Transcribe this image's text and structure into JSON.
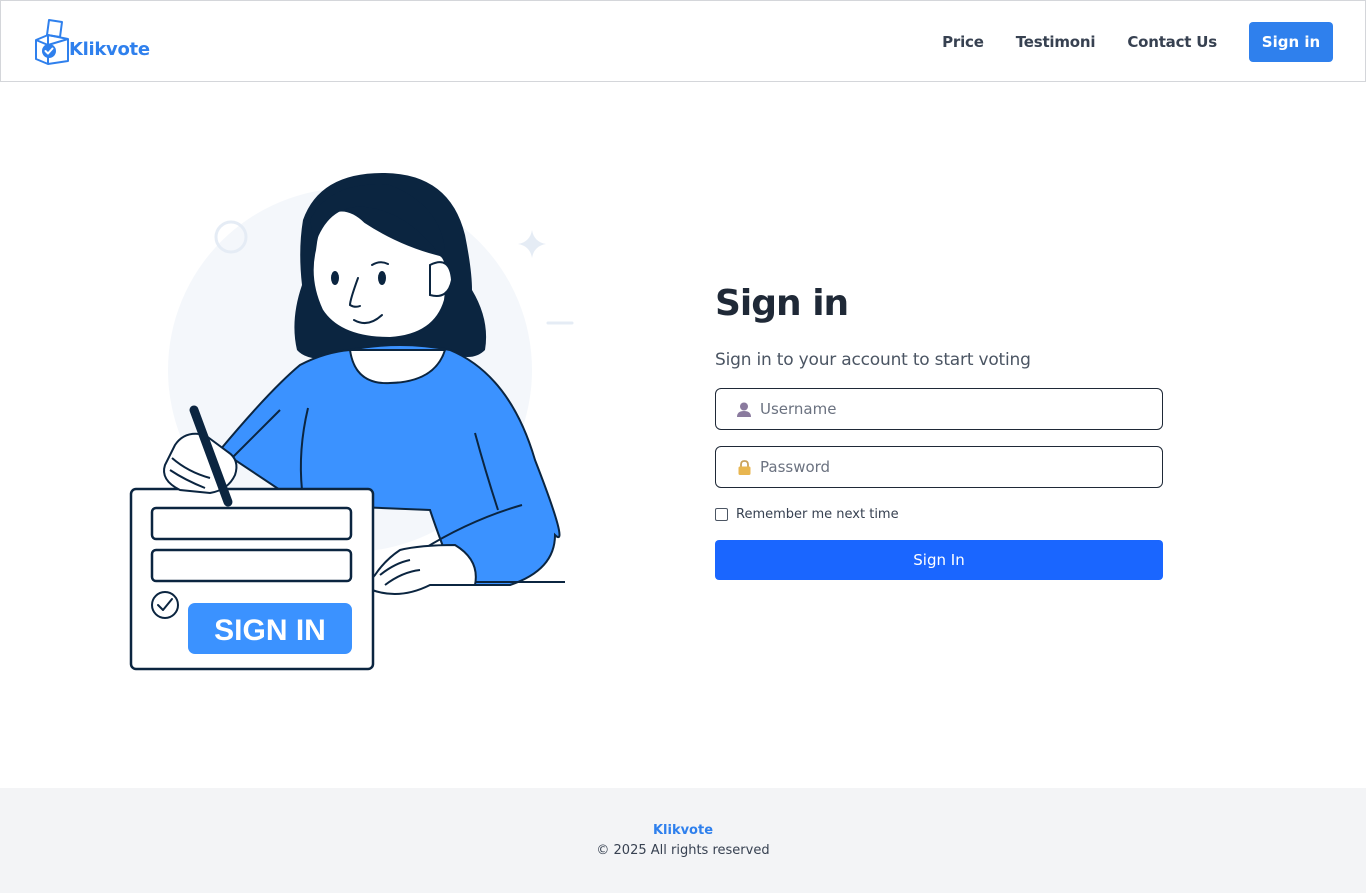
{
  "header": {
    "brand": "Klikvote",
    "nav": [
      {
        "label": "Price"
      },
      {
        "label": "Testimoni"
      },
      {
        "label": "Contact Us"
      }
    ],
    "signin_button": "Sign in"
  },
  "illustration": {
    "button_text": "SIGN IN"
  },
  "form": {
    "title": "Sign in",
    "subtitle": "Sign in to your account to start voting",
    "username_placeholder": "Username",
    "password_placeholder": "Password",
    "remember_label": "Remember me next time",
    "submit_label": "Sign In"
  },
  "footer": {
    "brand": "Klikvote",
    "copyright": "© 2025 All rights reserved"
  },
  "colors": {
    "brand_blue": "#2f80ed",
    "submit_blue": "#1a66ff",
    "illustration_blue": "#3b92ff",
    "hair_navy": "#0b2540",
    "footer_bg": "#f3f4f6"
  }
}
